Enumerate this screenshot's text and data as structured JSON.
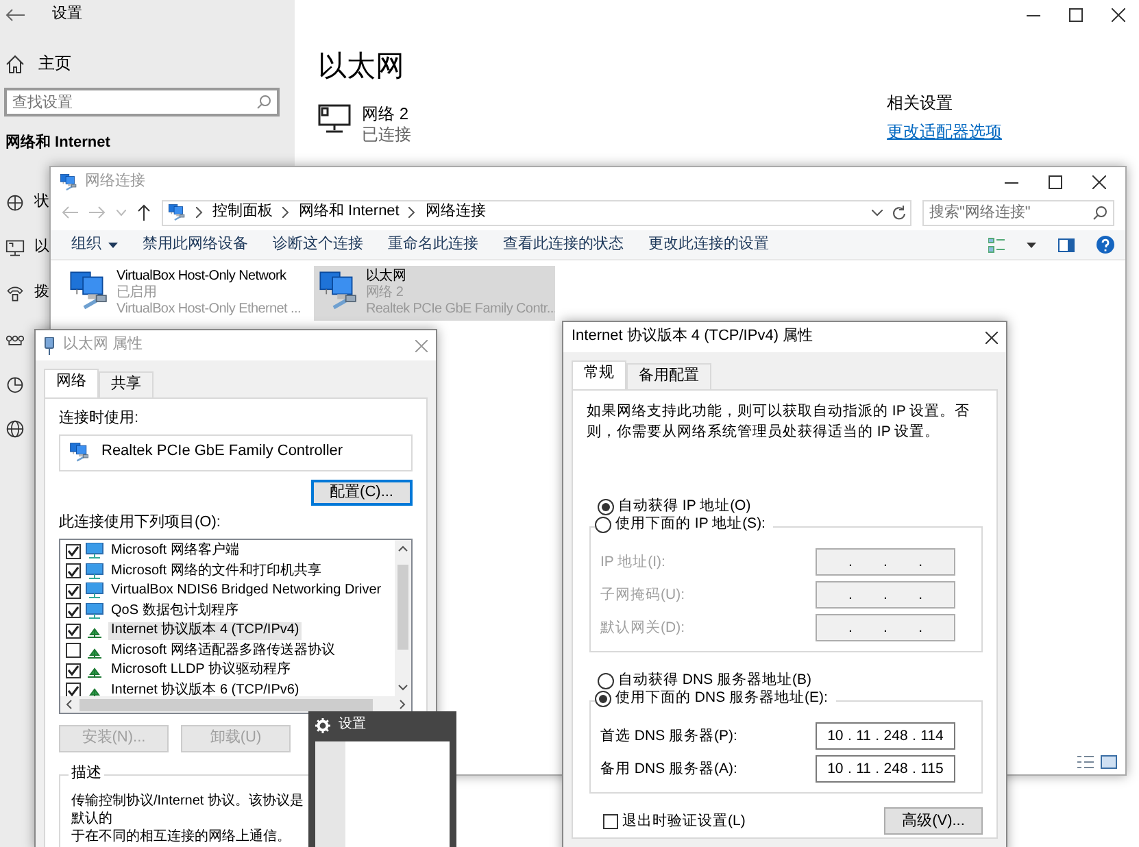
{
  "settings": {
    "title": "设置",
    "home": "主页",
    "search": {
      "placeholder": "查找设置"
    },
    "section": "网络和 Internet",
    "sidebar": {
      "items": [
        {
          "kind": "status",
          "label": "状"
        },
        {
          "kind": "ethernet",
          "label": "以"
        },
        {
          "kind": "dialup",
          "label": "拨"
        },
        {
          "kind": "vpn"
        },
        {
          "kind": "data"
        },
        {
          "kind": "proxy"
        }
      ]
    },
    "page_title": "以太网",
    "network": {
      "name": "网络 2",
      "status": "已连接"
    },
    "related": {
      "heading": "相关设置",
      "links": [
        "更改适配器选项"
      ]
    }
  },
  "connections_window": {
    "title": "网络连接",
    "breadcrumb": [
      "控制面板",
      "网络和 Internet",
      "网络连接"
    ],
    "search": {
      "placeholder": "搜索\"网络连接\""
    },
    "toolbar": [
      {
        "label": "组织",
        "dropdown": true
      },
      {
        "label": "禁用此网络设备",
        "dropdown": false
      },
      {
        "label": "诊断这个连接",
        "dropdown": false
      },
      {
        "label": "重命名此连接",
        "dropdown": false
      },
      {
        "label": "查看此连接的状态",
        "dropdown": false
      },
      {
        "label": "更改此连接的设置",
        "dropdown": false
      }
    ],
    "adapters": [
      {
        "name": "VirtualBox Host-Only Network",
        "status": "已启用",
        "device": "VirtualBox Host-Only Ethernet ...",
        "selected": false
      },
      {
        "name": "以太网",
        "status": "网络 2",
        "device": "Realtek PCIe GbE Family Contr...",
        "selected": true
      }
    ]
  },
  "properties_dialog": {
    "title": "以太网 属性",
    "tabs": [
      {
        "label": "网络",
        "selected": true
      },
      {
        "label": "共享",
        "selected": false
      }
    ],
    "connect_using_label": "连接时使用:",
    "adapter": "Realtek PCIe GbE Family Controller",
    "configure_button": "配置(C)...",
    "items_label": "此连接使用下列项目(O):",
    "items": [
      {
        "kind": "client",
        "label": "Microsoft 网络客户端",
        "checked": true,
        "selected": false
      },
      {
        "kind": "client",
        "label": "Microsoft 网络的文件和打印机共享",
        "checked": true,
        "selected": false
      },
      {
        "kind": "client",
        "label": "VirtualBox NDIS6 Bridged Networking Driver",
        "checked": true,
        "selected": false
      },
      {
        "kind": "client",
        "label": "QoS 数据包计划程序",
        "checked": true,
        "selected": false
      },
      {
        "kind": "protocol",
        "label": "Internet 协议版本 4 (TCP/IPv4)",
        "checked": true,
        "selected": true
      },
      {
        "kind": "protocol",
        "label": "Microsoft 网络适配器多路传送器协议",
        "checked": false,
        "selected": false
      },
      {
        "kind": "protocol",
        "label": "Microsoft LLDP 协议驱动程序",
        "checked": true,
        "selected": false
      },
      {
        "kind": "protocol",
        "label": "Internet 协议版本 6 (TCP/IPv6)",
        "checked": true,
        "selected": false
      }
    ],
    "buttons": [
      {
        "label": "安装(N)...",
        "disabled": true
      },
      {
        "label": "卸载(U)",
        "disabled": true
      }
    ],
    "description": {
      "legend": "描述",
      "lines": [
        "传输控制协议/Internet 协议。该协议是默认的",
        "于在不同的相互连接的网络上通信。"
      ]
    }
  },
  "thumbnail": {
    "title": "设置"
  },
  "ipv4_dialog": {
    "title": "Internet 协议版本 4 (TCP/IPv4) 属性",
    "tabs": [
      {
        "label": "常规",
        "selected": true
      },
      {
        "label": "备用配置",
        "selected": false
      }
    ],
    "intro": "如果网络支持此功能，则可以获取自动指派的 IP 设置。否则，你需要从网络系统管理员处获得适当的 IP 设置。",
    "separator": ".",
    "ip_mode": [
      {
        "label": "自动获得 IP 地址(O)",
        "selected": true
      },
      {
        "label": "使用下面的 IP 地址(S):",
        "selected": false
      }
    ],
    "ip_fields": {
      "disabled": true,
      "fields": [
        {
          "label": "IP 地址(I):"
        },
        {
          "label": "子网掩码(U):"
        },
        {
          "label": "默认网关(D):"
        }
      ]
    },
    "dns_mode": [
      {
        "label": "自动获得 DNS 服务器地址(B)",
        "selected": false
      },
      {
        "label": "使用下面的 DNS 服务器地址(E):",
        "selected": true
      }
    ],
    "dns_fields": {
      "disabled": false,
      "fields": [
        {
          "label": "首选 DNS 服务器(P):",
          "octets": [
            "10",
            "11",
            "248",
            "114"
          ]
        },
        {
          "label": "备用 DNS 服务器(A):",
          "octets": [
            "10",
            "11",
            "248",
            "115"
          ]
        }
      ]
    },
    "validate": {
      "label": "退出时验证设置(L)",
      "checked": false
    },
    "advanced_button": "高级(V)..."
  }
}
